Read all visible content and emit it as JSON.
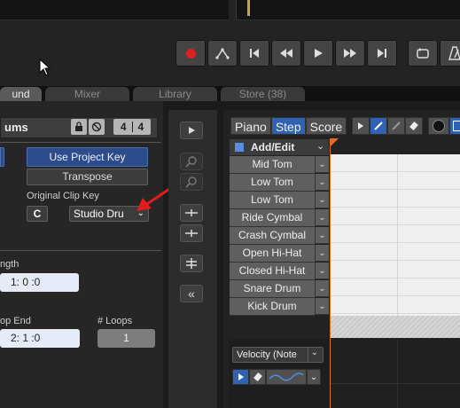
{
  "transport": {
    "buttons": [
      "record",
      "metronome-style",
      "go-to-start",
      "rewind",
      "play",
      "fast-forward",
      "go-to-end",
      "loop",
      "metronome"
    ],
    "record_color": "#e02020"
  },
  "tabs": [
    {
      "label": "und",
      "active": true
    },
    {
      "label": "Mixer",
      "active": false
    },
    {
      "label": "Library",
      "active": false
    },
    {
      "label": "Store (38)",
      "active": false
    }
  ],
  "clip": {
    "name_partial": "ums",
    "time_sig_num": "4",
    "time_sig_den": "4",
    "use_project_key": "Use Project Key",
    "transpose": "Transpose",
    "original_clip_key_label": "Original Clip Key",
    "key_value": "C",
    "scale_value": "Studio Dru",
    "length_label": "ngth",
    "length_value": "1:  0  :0",
    "loop_end_label": "op End",
    "loop_end_value": "2:  1  :0",
    "loops_label": "# Loops",
    "loops_value": "1"
  },
  "editor": {
    "tabs": [
      {
        "label": "Piano",
        "active": false
      },
      {
        "label": "Step",
        "active": true
      },
      {
        "label": "Score",
        "active": false
      }
    ],
    "add_edit": "Add/Edit",
    "pitches": [
      "Mid Tom",
      "Low Tom",
      "Low Tom",
      "Ride Cymbal",
      "Crash Cymbal",
      "Open Hi-Hat",
      "Closed Hi-Hat",
      "Snare Drum",
      "Kick Drum"
    ],
    "velocity_dropdown": "Velocity (Note",
    "accent_blue": "#2f62b3",
    "playhead_color": "#e36b1d"
  },
  "annotation": {
    "arrow_color": "#e21b1b"
  }
}
